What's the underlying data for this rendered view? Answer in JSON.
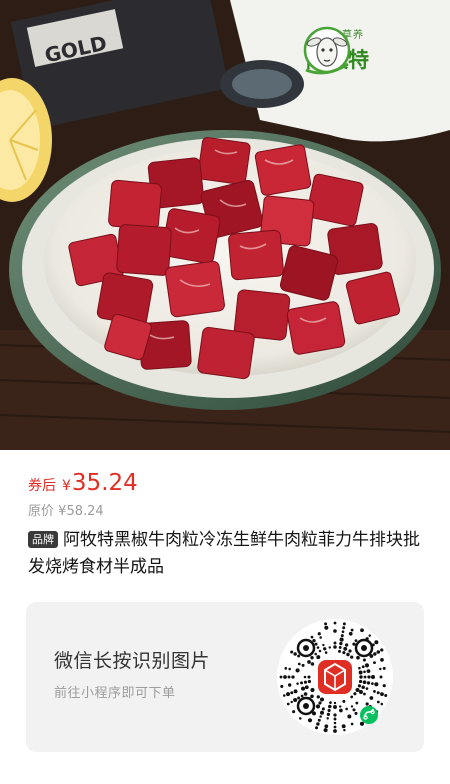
{
  "product_image": {
    "logo_slogan": "天生草养",
    "logo_name": "阿牧特",
    "box_text": "GOLD"
  },
  "price": {
    "label": "券后",
    "currency": "¥",
    "value": "35.24"
  },
  "original_price": {
    "label": "原价",
    "currency": "¥",
    "value": "58.24"
  },
  "product": {
    "brand_tag": "品牌",
    "title": "阿牧特黑椒牛肉粒冷冻生鲜牛肉粒菲力牛排块批发烧烤食材半成品"
  },
  "qr_card": {
    "main_text": "微信长按识别图片",
    "sub_text": "前往小程序即可下单",
    "center_icon": "pinduoduo-logo-icon",
    "badge_icon": "wechat-mini-program-icon"
  },
  "colors": {
    "price_red": "#e02e24",
    "brand_green": "#2f8a1f",
    "card_bg": "#f2f2f2"
  }
}
